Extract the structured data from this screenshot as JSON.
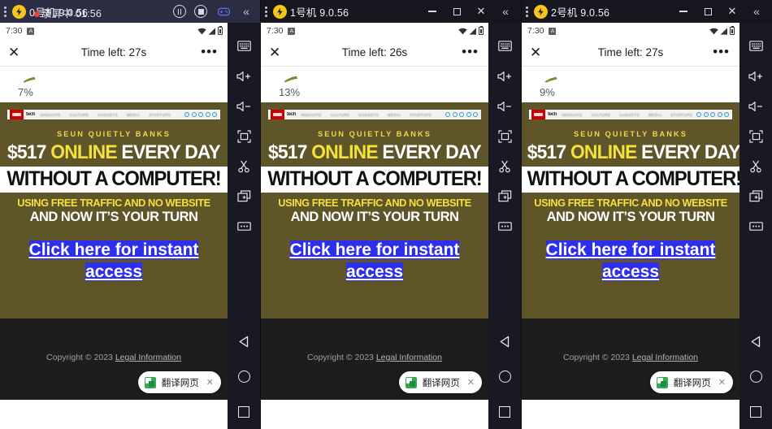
{
  "window": {
    "brand_icon": "ldplayer-logo-icon",
    "menu_icon": "vertical-dots-icon",
    "collapse_icon": "double-chevron-left-icon",
    "gamepad_icon": "gamepad-icon",
    "pause_icon": "pause-recording-icon",
    "stop_icon": "stop-recording-icon",
    "minimize_icon": "minimize-icon",
    "maximize_icon": "maximize-icon",
    "close_icon": "close-icon"
  },
  "panels": [
    {
      "title": "0号机 9.0.56",
      "recording_overlay": "录屏中 01:56",
      "recording_active": true,
      "show_window_controls": false,
      "status_bar": {
        "time": "7:30",
        "badge": "A",
        "wifi_icon": "wifi-icon",
        "signal_icon": "signal-icon",
        "battery_icon": "battery-icon"
      },
      "ad_bar": {
        "close_label": "✕",
        "time_left": "Time left: 27s",
        "more_label": "•••"
      },
      "progress": {
        "percent": "7%",
        "swoosh_color": "#7d8b2b"
      },
      "toast": {
        "label": "翻译网页",
        "close": "✕",
        "icon": "google-translate-icon"
      }
    },
    {
      "title": "1号机 9.0.56",
      "recording_overlay": "",
      "recording_active": false,
      "show_window_controls": true,
      "status_bar": {
        "time": "7:30",
        "badge": "A",
        "wifi_icon": "wifi-icon",
        "signal_icon": "signal-icon",
        "battery_icon": "battery-icon"
      },
      "ad_bar": {
        "close_label": "✕",
        "time_left": "Time left: 26s",
        "more_label": "•••"
      },
      "progress": {
        "percent": "13%",
        "swoosh_color": "#7d8b2b"
      },
      "toast": {
        "label": "翻译网页",
        "close": "✕",
        "icon": "google-translate-icon"
      }
    },
    {
      "title": "2号机 9.0.56",
      "recording_overlay": "",
      "recording_active": false,
      "show_window_controls": true,
      "status_bar": {
        "time": "7:30",
        "badge": "A",
        "wifi_icon": "wifi-icon",
        "signal_icon": "signal-icon",
        "battery_icon": "battery-icon"
      },
      "ad_bar": {
        "close_label": "✕",
        "time_left": "Time left: 27s",
        "more_label": "•••"
      },
      "progress": {
        "percent": "9%",
        "swoosh_color": "#7d8b2b"
      },
      "toast": {
        "label": "翻译网页",
        "close": "✕",
        "icon": "google-translate-icon"
      }
    }
  ],
  "ad": {
    "site_bar": {
      "logo": "CNN",
      "section": "tech",
      "nav_items": [
        "INNOVATE",
        "CULTURE",
        "GADGETS",
        "MEDIA",
        "STARTUPS"
      ],
      "social_icons": [
        "facebook-icon",
        "twitter-icon",
        "instagram-icon",
        "youtube-icon",
        "rss-icon"
      ]
    },
    "kicker": "SEUN QUIETLY BANKS",
    "headline_part1": "$517 ",
    "headline_highlight": "ONLINE",
    "headline_part2": " EVERY DAY",
    "headline_boxed": "WITHOUT A COMPUTER!",
    "subline1": "USING FREE TRAFFIC AND NO WEBSITE",
    "subline2": "AND NOW IT’S YOUR TURN",
    "cta": "Click here for instant access",
    "footer_copyright": "Copyright © 2023 ",
    "footer_link": "Legal Information",
    "colors": {
      "background": "#5e5529",
      "highlight": "#f5e03c",
      "kicker": "#f3d54e",
      "cta_background": "#2e2ef0",
      "footer_background": "#1d1d1d"
    }
  },
  "toolbar": {
    "items": [
      {
        "icon": "keyboard-icon",
        "label": "Keyboard"
      },
      {
        "icon": "volume-up-icon",
        "label": "Volume up"
      },
      {
        "icon": "volume-down-icon",
        "label": "Volume down"
      },
      {
        "icon": "fullscreen-icon",
        "label": "Fullscreen"
      },
      {
        "icon": "scissors-icon",
        "label": "Screenshot"
      },
      {
        "icon": "multi-instance-icon",
        "label": "New instance"
      },
      {
        "icon": "more-icon",
        "label": "More"
      }
    ],
    "nav": [
      {
        "icon": "back-icon",
        "label": "Back"
      },
      {
        "icon": "home-icon",
        "label": "Home"
      },
      {
        "icon": "recents-icon",
        "label": "Recents"
      }
    ]
  }
}
